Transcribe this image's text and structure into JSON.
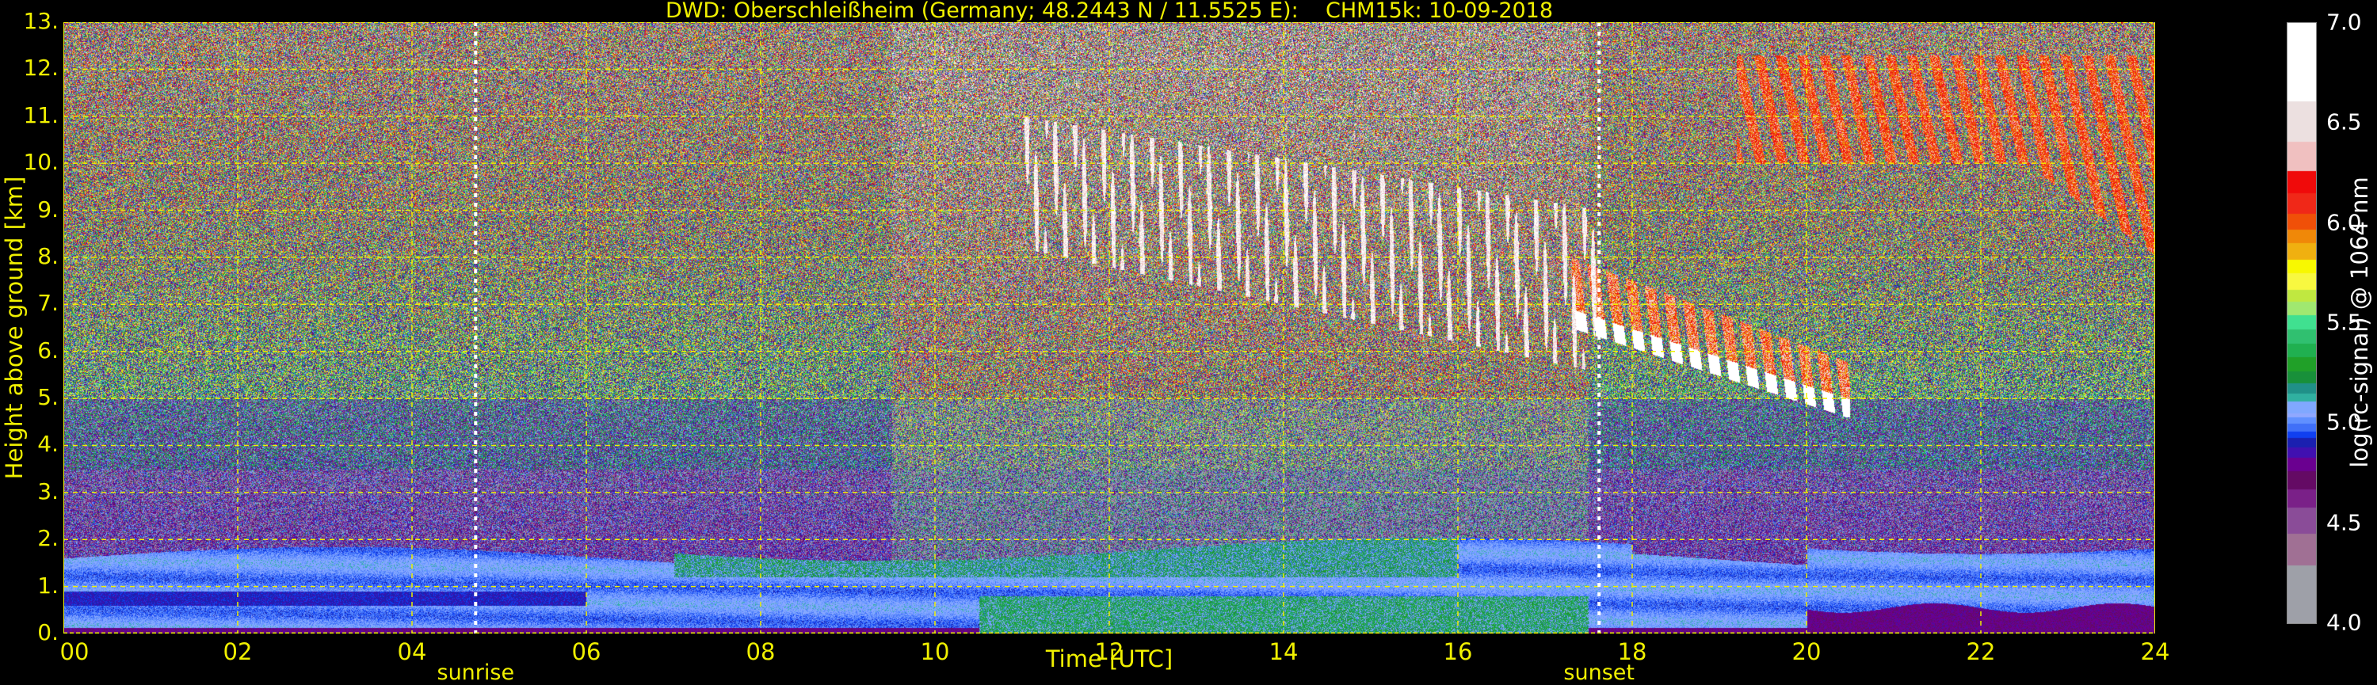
{
  "chart_data": {
    "type": "heatmap",
    "title": "DWD: Oberschleißheim (Germany; 48.2443 N / 11.5525 E):    CHM15k: 10-09-2018",
    "xlabel": "Time [UTC]",
    "ylabel": "Height above ground [km]",
    "xlim": [
      0,
      24
    ],
    "ylim": [
      0,
      13
    ],
    "xticks": [
      0,
      2,
      4,
      6,
      8,
      10,
      12,
      14,
      16,
      18,
      20,
      22,
      24
    ],
    "xtick_labels": [
      "00",
      "02",
      "04",
      "06",
      "08",
      "10",
      "12",
      "14",
      "16",
      "18",
      "20",
      "22",
      "24"
    ],
    "ytick_labels": [
      "0.",
      "1.",
      "2.",
      "3.",
      "4.",
      "5.",
      "6.",
      "7.",
      "8.",
      "9.",
      "10.",
      "11.",
      "12.",
      "13."
    ],
    "grid": true,
    "annotations": [
      {
        "label": "sunrise",
        "time_h": 4.73
      },
      {
        "label": "sunset",
        "time_h": 17.62
      }
    ],
    "colorbar": {
      "label": "log(rc-signal) @ 1064 nm",
      "range": [
        4.0,
        7.0
      ],
      "tick_labels": [
        "4.0",
        "4.5",
        "5.0",
        "5.5",
        "6.0",
        "6.5",
        "7.0"
      ],
      "levels": [
        {
          "from": 4.0,
          "color": "#9ea0a8"
        },
        {
          "from": 4.29,
          "color": "#a07094"
        },
        {
          "from": 4.45,
          "color": "#8a4c98"
        },
        {
          "from": 4.58,
          "color": "#7a2088"
        },
        {
          "from": 4.67,
          "color": "#640a64"
        },
        {
          "from": 4.76,
          "color": "#6a0090"
        },
        {
          "from": 4.83,
          "color": "#4010b0"
        },
        {
          "from": 4.88,
          "color": "#1a20b0"
        },
        {
          "from": 4.93,
          "color": "#1040f0"
        },
        {
          "from": 4.96,
          "color": "#4070f8"
        },
        {
          "from": 5.0,
          "color": "#6090ff"
        },
        {
          "from": 5.03,
          "color": "#90a8ff"
        },
        {
          "from": 5.05,
          "color": "#80a8ff"
        },
        {
          "from": 5.11,
          "color": "#30b0a0"
        },
        {
          "from": 5.15,
          "color": "#209088"
        },
        {
          "from": 5.2,
          "color": "#18903a"
        },
        {
          "from": 5.26,
          "color": "#20a028"
        },
        {
          "from": 5.33,
          "color": "#20b050"
        },
        {
          "from": 5.4,
          "color": "#30c070"
        },
        {
          "from": 5.47,
          "color": "#40e090"
        },
        {
          "from": 5.54,
          "color": "#a0e870"
        },
        {
          "from": 5.61,
          "color": "#c0e840"
        },
        {
          "from": 5.67,
          "color": "#f8f840"
        },
        {
          "from": 5.75,
          "color": "#f8f800"
        },
        {
          "from": 5.82,
          "color": "#f0b010"
        },
        {
          "from": 5.9,
          "color": "#f08808"
        },
        {
          "from": 5.97,
          "color": "#f05008"
        },
        {
          "from": 6.05,
          "color": "#f02818"
        },
        {
          "from": 6.15,
          "color": "#f00a0a"
        },
        {
          "from": 6.26,
          "color": "#f0c0c0"
        },
        {
          "from": 6.41,
          "color": "#ece0e0"
        },
        {
          "from": 6.61,
          "color": "#ffffff"
        }
      ]
    },
    "features": [
      {
        "kind": "boundary_layer",
        "time_h": [
          0,
          24
        ],
        "top_km": [
          1.6,
          2.1
        ],
        "value": 5.0
      },
      {
        "kind": "cirrus",
        "time_h": [
          11,
          17.6
        ],
        "height_km": [
          5.5,
          11.5
        ],
        "value": 6.8
      },
      {
        "kind": "cloud",
        "time_h": [
          17.6,
          20.5
        ],
        "height_km": [
          4.6,
          8
        ],
        "value": 6.5
      },
      {
        "kind": "cirrus",
        "time_h": [
          19.2,
          24
        ],
        "height_km": [
          8,
          12.5
        ],
        "value": 6.0
      }
    ]
  },
  "colors": {
    "axis_text": "#f0f000",
    "grid": "#f0f000",
    "background": "#000000"
  }
}
